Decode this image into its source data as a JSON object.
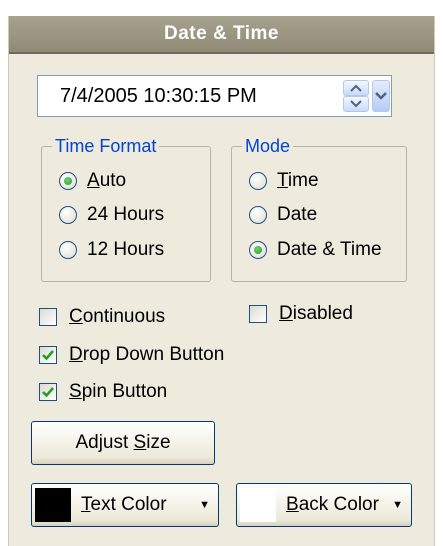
{
  "title": "Date & Time",
  "datetime": {
    "value": "7/4/2005 10:30:15 PM"
  },
  "time_format": {
    "legend": "Time Format",
    "options": [
      {
        "label_u": "A",
        "label_rest": "uto",
        "selected": true
      },
      {
        "label_u": "",
        "label_rest": "24 Hours",
        "selected": false
      },
      {
        "label_u": "",
        "label_rest": "12 Hours",
        "selected": false
      }
    ]
  },
  "mode": {
    "legend": "Mode",
    "options": [
      {
        "label_u": "T",
        "label_rest": "ime",
        "selected": false
      },
      {
        "label_u": "",
        "label_rest": "Date",
        "selected": false
      },
      {
        "label_u": "",
        "label_rest": "Date & Time",
        "selected": true
      }
    ]
  },
  "checkboxes": {
    "continuous": {
      "u": "C",
      "rest": "ontinuous",
      "checked": false
    },
    "disabled": {
      "u": "D",
      "rest": "isabled",
      "checked": false
    },
    "drop_down_button": {
      "u": "D",
      "rest": "rop Down Button",
      "checked": true
    },
    "spin_button": {
      "u": "S",
      "rest": "pin Button",
      "checked": true
    }
  },
  "adjust_size": {
    "pre": "Adjust ",
    "u": "S",
    "rest": "ize"
  },
  "text_color": {
    "u": "T",
    "rest": "ext Color",
    "swatch": "#000000"
  },
  "back_color": {
    "u": "B",
    "rest": "ack Color",
    "swatch": "#ffffff"
  },
  "colors": {
    "title_bg": "#9a9682",
    "panel_bg": "#eeeade",
    "legend": "#0046d5",
    "radio_selected": "#21a121",
    "check": "#21a121"
  }
}
